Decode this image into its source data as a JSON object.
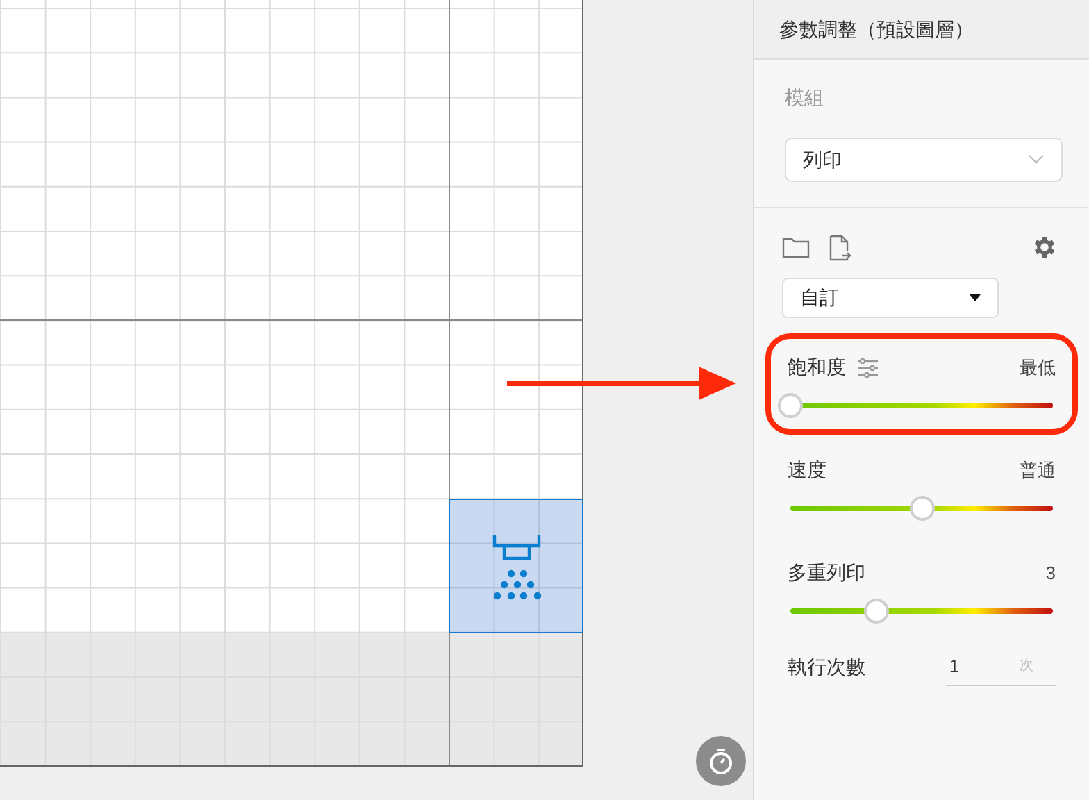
{
  "canvas": {
    "selected_block": {
      "selected": true
    }
  },
  "panel": {
    "title": "參數調整（預設圖層）",
    "module_label": "模組",
    "module_value": "列印",
    "preset_value": "自訂"
  },
  "sliders": [
    {
      "kind": "adjustable",
      "label": "飽和度",
      "reading": "最低",
      "level": 0,
      "highlighted": true
    },
    {
      "kind": "plain",
      "label": "速度",
      "reading": "普通",
      "level": 0.5,
      "highlighted": false
    },
    {
      "kind": "plain",
      "label": "多重列印",
      "reading": "3",
      "level": 0.33,
      "highlighted": false
    }
  ],
  "run_count": {
    "label": "執行次數",
    "value": "1",
    "unit": "次"
  }
}
